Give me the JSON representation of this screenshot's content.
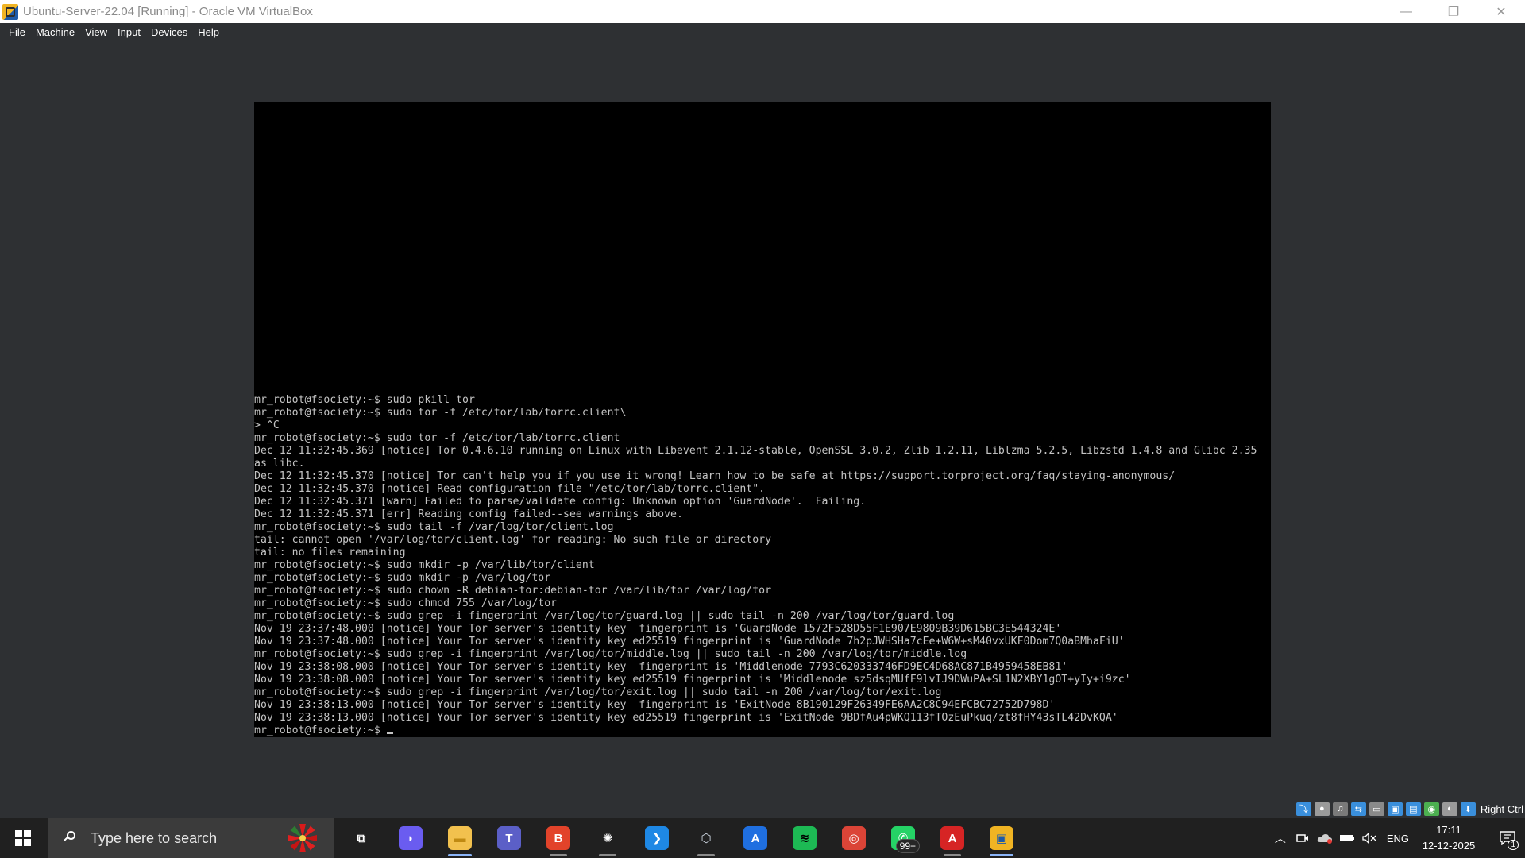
{
  "window": {
    "title": "Ubuntu-Server-22.04 [Running] - Oracle VM VirtualBox",
    "minimize_glyph": "—",
    "restore_glyph": "❐",
    "close_glyph": "✕"
  },
  "menu": {
    "items": [
      "File",
      "Machine",
      "View",
      "Input",
      "Devices",
      "Help"
    ]
  },
  "console": {
    "lines": [
      "mr_robot@fsociety:~$ sudo pkill tor",
      "mr_robot@fsociety:~$ sudo tor -f /etc/tor/lab/torrc.client\\",
      "> ^C",
      "mr_robot@fsociety:~$ sudo tor -f /etc/tor/lab/torrc.client",
      "Dec 12 11:32:45.369 [notice] Tor 0.4.6.10 running on Linux with Libevent 2.1.12-stable, OpenSSL 3.0.2, Zlib 1.2.11, Liblzma 5.2.5, Libzstd 1.4.8 and Glibc 2.35",
      "as libc.",
      "Dec 12 11:32:45.370 [notice] Tor can't help you if you use it wrong! Learn how to be safe at https://support.torproject.org/faq/staying-anonymous/",
      "Dec 12 11:32:45.370 [notice] Read configuration file \"/etc/tor/lab/torrc.client\".",
      "Dec 12 11:32:45.371 [warn] Failed to parse/validate config: Unknown option 'GuardNode'.  Failing.",
      "Dec 12 11:32:45.371 [err] Reading config failed--see warnings above.",
      "mr_robot@fsociety:~$ sudo tail -f /var/log/tor/client.log",
      "tail: cannot open '/var/log/tor/client.log' for reading: No such file or directory",
      "tail: no files remaining",
      "mr_robot@fsociety:~$ sudo mkdir -p /var/lib/tor/client",
      "mr_robot@fsociety:~$ sudo mkdir -p /var/log/tor",
      "mr_robot@fsociety:~$ sudo chown -R debian-tor:debian-tor /var/lib/tor /var/log/tor",
      "mr_robot@fsociety:~$ sudo chmod 755 /var/log/tor",
      "mr_robot@fsociety:~$ sudo grep -i fingerprint /var/log/tor/guard.log || sudo tail -n 200 /var/log/tor/guard.log",
      "Nov 19 23:37:48.000 [notice] Your Tor server's identity key  fingerprint is 'GuardNode 1572F528D55F1E907E9809B39D615BC3E544324E'",
      "Nov 19 23:37:48.000 [notice] Your Tor server's identity key ed25519 fingerprint is 'GuardNode 7h2pJWHSHa7cEe+W6W+sM40vxUKF0Dom7Q0aBMhaFiU'",
      "mr_robot@fsociety:~$ sudo grep -i fingerprint /var/log/tor/middle.log || sudo tail -n 200 /var/log/tor/middle.log",
      "Nov 19 23:38:08.000 [notice] Your Tor server's identity key  fingerprint is 'Middlenode 7793C620333746FD9EC4D68AC871B4959458EB81'",
      "Nov 19 23:38:08.000 [notice] Your Tor server's identity key ed25519 fingerprint is 'Middlenode sz5dsqMUfF9lvIJ9DWuPA+SL1N2XBY1gOT+yIy+i9zc'",
      "mr_robot@fsociety:~$ sudo grep -i fingerprint /var/log/tor/exit.log || sudo tail -n 200 /var/log/tor/exit.log",
      "Nov 19 23:38:13.000 [notice] Your Tor server's identity key  fingerprint is 'ExitNode 8B190129F26349FE6AA2C8C94EFCBC72752D798D'",
      "Nov 19 23:38:13.000 [notice] Your Tor server's identity key ed25519 fingerprint is 'ExitNode 9BDfAu4pWKQ113fTOzEuPkuq/zt8fHY43sTL42DvKQA'"
    ],
    "prompt": "mr_robot@fsociety:~$ "
  },
  "vbox_status": {
    "host_key": "Right Ctrl",
    "icons": [
      {
        "name": "hard-disk-icon",
        "color": "#3a8fdc",
        "glyph": "⤵"
      },
      {
        "name": "optical-drive-icon",
        "color": "#9a9a9a",
        "glyph": "●"
      },
      {
        "name": "audio-icon",
        "color": "#7a7a7a",
        "glyph": "♫"
      },
      {
        "name": "network-icon",
        "color": "#3a8fdc",
        "glyph": "⇆"
      },
      {
        "name": "usb-icon",
        "color": "#8a8a8a",
        "glyph": "▭"
      },
      {
        "name": "shared-folders-icon",
        "color": "#3a8fdc",
        "glyph": "▣"
      },
      {
        "name": "display-icon",
        "color": "#3a8fdc",
        "glyph": "▤"
      },
      {
        "name": "recording-icon",
        "color": "#4caf50",
        "glyph": "◉"
      },
      {
        "name": "mouse-integration-icon",
        "color": "#9a9a9a",
        "glyph": "◐"
      },
      {
        "name": "keyboard-capture-icon",
        "color": "#3a8fdc",
        "glyph": "⬇"
      }
    ]
  },
  "taskbar": {
    "search_placeholder": "Type here to search",
    "apps": [
      {
        "name": "task-view-icon",
        "glyph": "⧉",
        "bg": "transparent",
        "fg": "#ffffff",
        "state": ""
      },
      {
        "name": "copilot-icon",
        "glyph": "◗",
        "bg": "#6a5cf0",
        "fg": "#ffffff",
        "state": ""
      },
      {
        "name": "file-explorer-icon",
        "glyph": "▬",
        "bg": "#f2c14e",
        "fg": "#c08a12",
        "state": "active"
      },
      {
        "name": "teams-icon",
        "glyph": "T",
        "bg": "#5b5fc7",
        "fg": "#ffffff",
        "state": ""
      },
      {
        "name": "brave-icon",
        "glyph": "B",
        "bg": "#e2432a",
        "fg": "#ffffff",
        "state": "running"
      },
      {
        "name": "chatgpt-icon",
        "glyph": "✺",
        "bg": "transparent",
        "fg": "#ffffff",
        "state": "running"
      },
      {
        "name": "vscode-icon",
        "glyph": "❯",
        "bg": "#1e88e5",
        "fg": "#ffffff",
        "state": ""
      },
      {
        "name": "virtualbox-icon",
        "glyph": "⬡",
        "bg": "transparent",
        "fg": "#cfd8e3",
        "state": "running"
      },
      {
        "name": "app-store-icon",
        "glyph": "A",
        "bg": "#1f6fe0",
        "fg": "#ffffff",
        "state": ""
      },
      {
        "name": "spotify-icon",
        "glyph": "≋",
        "bg": "#1db954",
        "fg": "#000000",
        "state": ""
      },
      {
        "name": "chrome-icon",
        "glyph": "◎",
        "bg": "#db4437",
        "fg": "#ffffff",
        "state": ""
      },
      {
        "name": "whatsapp-icon",
        "glyph": "✆",
        "bg": "#25d366",
        "fg": "#ffffff",
        "state": "",
        "badge": "99+"
      },
      {
        "name": "acrobat-icon",
        "glyph": "A",
        "bg": "#d62424",
        "fg": "#ffffff",
        "state": "running"
      },
      {
        "name": "virtualbox-vm-icon",
        "glyph": "▣",
        "bg": "#f0b423",
        "fg": "#1d5aa8",
        "state": "active"
      }
    ],
    "tray": {
      "chevron": "︿",
      "language": "ENG",
      "time": "17:11",
      "date": "12-12-2025",
      "notification_count": "1"
    }
  }
}
